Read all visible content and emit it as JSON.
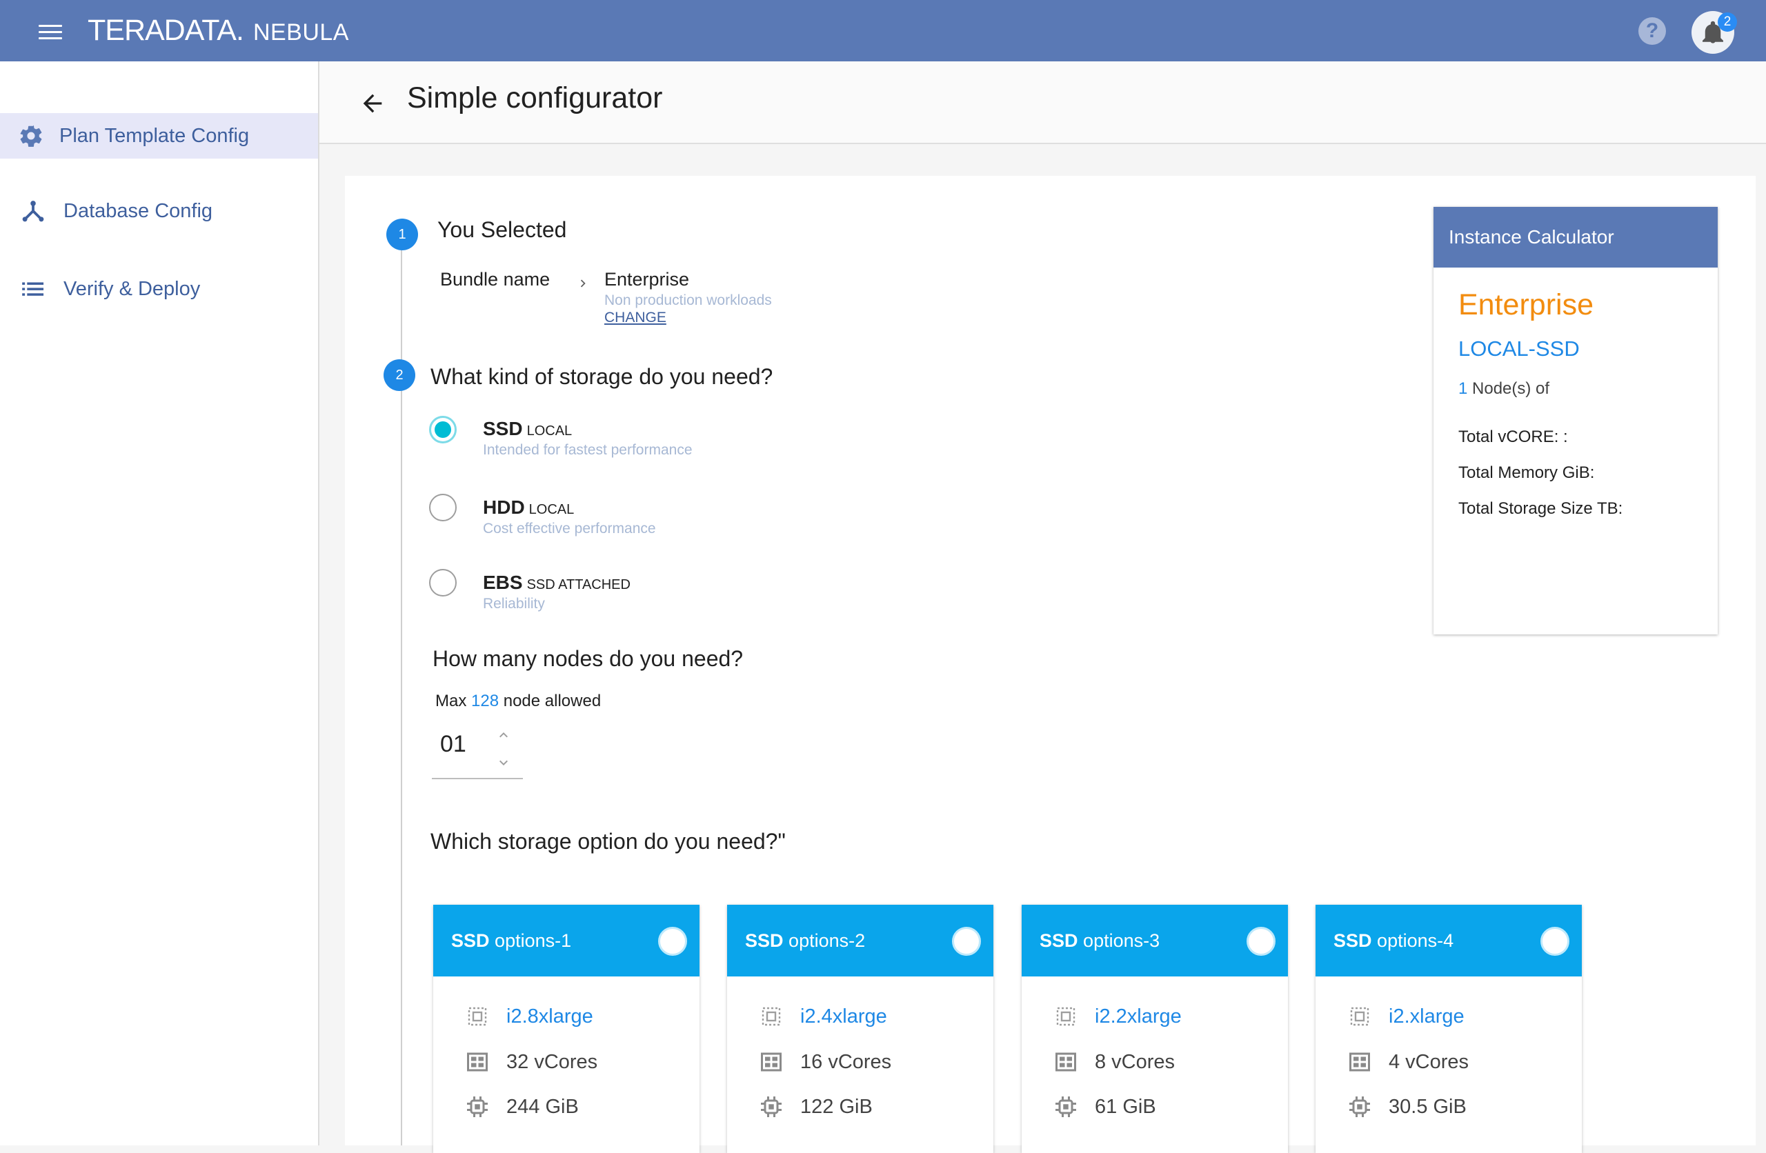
{
  "header": {
    "brand_main": "TERADATA.",
    "brand_sub": "NEBULA",
    "help_label": "?",
    "notification_count": "2"
  },
  "sidebar": {
    "items": [
      {
        "label": "Plan Template Config",
        "icon": "gear-icon",
        "active": true
      },
      {
        "label": "Database Config",
        "icon": "network-icon",
        "active": false
      },
      {
        "label": "Verify & Deploy",
        "icon": "list-icon",
        "active": false
      }
    ]
  },
  "page": {
    "title": "Simple configurator"
  },
  "step1": {
    "number": "1",
    "heading": "You Selected",
    "bundle_label": "Bundle name",
    "bundle_value": "Enterprise",
    "bundle_desc": "Non production workloads",
    "change_link": "CHANGE"
  },
  "step2": {
    "number": "2",
    "heading": "What kind of storage do you need?",
    "options": [
      {
        "name": "SSD",
        "tag": "LOCAL",
        "desc": "Intended for fastest performance",
        "selected": true
      },
      {
        "name": "HDD",
        "tag": "LOCAL",
        "desc": "Cost effective performance",
        "selected": false
      },
      {
        "name": "EBS",
        "tag": "SSD ATTACHED",
        "desc": "Reliability",
        "selected": false
      }
    ]
  },
  "nodes": {
    "heading": "How many nodes do you need?",
    "max_prefix": "Max",
    "max_value": "128",
    "max_suffix": "node allowed",
    "value": "01"
  },
  "storage_option": {
    "heading": "Which storage option do you need?\"",
    "cards": [
      {
        "title_bold": "SSD",
        "title_rest": "options-1",
        "instance": "i2.8xlarge",
        "vcores": "32 vCores",
        "memory": "244 GiB"
      },
      {
        "title_bold": "SSD",
        "title_rest": "options-2",
        "instance": "i2.4xlarge",
        "vcores": "16 vCores",
        "memory": "122 GiB"
      },
      {
        "title_bold": "SSD",
        "title_rest": "options-3",
        "instance": "i2.2xlarge",
        "vcores": "8 vCores",
        "memory": "61 GiB"
      },
      {
        "title_bold": "SSD",
        "title_rest": "options-4",
        "instance": "i2.xlarge",
        "vcores": "4 vCores",
        "memory": "30.5 GiB"
      }
    ]
  },
  "calculator": {
    "title": "Instance Calculator",
    "bundle": "Enterprise",
    "storage": "LOCAL-SSD",
    "node_count": "1",
    "node_suffix": "Node(s) of",
    "total_vcore": "Total vCORE: :",
    "total_memory": "Total Memory GiB:",
    "total_storage": "Total Storage Size TB:"
  },
  "colors": {
    "header": "#5a79b5",
    "accent_blue": "#1e88e5",
    "option_header": "#0aa5eb",
    "calc_bundle": "#f28c0f",
    "radio_selected": "#00bcd4"
  }
}
